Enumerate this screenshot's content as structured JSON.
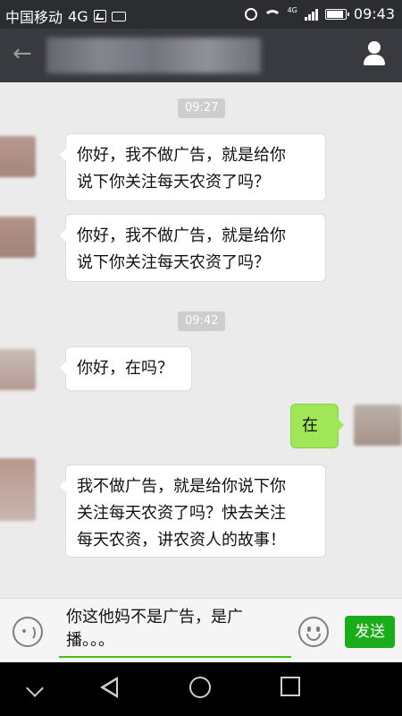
{
  "status_bar": {
    "carrier": "中国移动",
    "network": "4G",
    "signal_network": "4G",
    "time": "09:43"
  },
  "title_bar": {
    "back_icon": "back-arrow-icon",
    "profile_icon": "person-icon"
  },
  "messages": [
    {
      "type": "timestamp",
      "text": "09:27"
    },
    {
      "type": "received",
      "text": "你好，我不做广告，就是给你\n说下你关注每天农资了吗？"
    },
    {
      "type": "received",
      "text": "你好，我不做广告，就是给你\n说下你关注每天农资了吗？"
    },
    {
      "type": "timestamp",
      "text": "09:42"
    },
    {
      "type": "received",
      "text": "你好，在吗？"
    },
    {
      "type": "sent",
      "text": "在"
    },
    {
      "type": "received",
      "text": "我不做广告，就是给你说下你\n关注每天农资了吗？快去关注\n每天农资，讲农资人的故事！"
    }
  ],
  "input_bar": {
    "voice_icon": "voice-icon",
    "draft_text": "你这他妈不是广告，是广\n播。。。",
    "emoji_icon": "emoji-icon",
    "send_label": "发送"
  },
  "colors": {
    "header_bg": "#393a3f",
    "status_bg": "#2c2d31",
    "chat_bg": "#ebebeb",
    "sent_bubble": "#9fe658",
    "send_button": "#1aad19",
    "input_underline": "#45c01a"
  }
}
